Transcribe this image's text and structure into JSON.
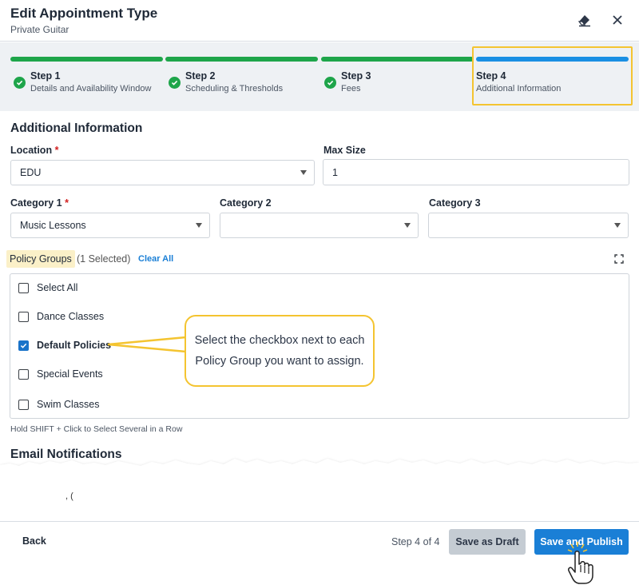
{
  "header": {
    "title": "Edit Appointment Type",
    "subtitle": "Private Guitar"
  },
  "steps": [
    {
      "title": "Step 1",
      "subtitle": "Details and Availability Window",
      "status": "complete"
    },
    {
      "title": "Step 2",
      "subtitle": "Scheduling & Thresholds",
      "status": "complete"
    },
    {
      "title": "Step 3",
      "subtitle": "Fees",
      "status": "complete"
    },
    {
      "title": "Step 4",
      "subtitle": "Additional Information",
      "status": "current"
    }
  ],
  "colors": {
    "complete": "#1ea54a",
    "current": "#1a8fe3",
    "highlight": "#f4c430",
    "primary": "#1a7fd6"
  },
  "section": {
    "title": "Additional Information"
  },
  "fields": {
    "location": {
      "label": "Location",
      "value": "EDU",
      "required": "*"
    },
    "max_size": {
      "label": "Max Size",
      "value": "1"
    },
    "category1": {
      "label": "Category 1",
      "value": "Music Lessons",
      "required": "*"
    },
    "category2": {
      "label": "Category 2",
      "value": ""
    },
    "category3": {
      "label": "Category 3",
      "value": ""
    }
  },
  "policy_groups": {
    "label": "Policy Groups",
    "count": "(1 Selected)",
    "clear": "Clear All",
    "items": [
      {
        "label": "Select All",
        "checked": false
      },
      {
        "label": "Dance Classes",
        "checked": false
      },
      {
        "label": "Default Policies",
        "checked": true
      },
      {
        "label": "Special Events",
        "checked": false
      },
      {
        "label": "Swim Classes",
        "checked": false
      }
    ],
    "hint": "Hold SHIFT + Click to Select Several in a Row"
  },
  "callout": {
    "text": "Select the checkbox next to each Policy Group you want to assign."
  },
  "email": {
    "title": "Email Notifications"
  },
  "stray_text": ", (",
  "footer": {
    "back": "Back",
    "step_of": "Step 4 of 4",
    "draft": "Save as Draft",
    "publish": "Save and Publish"
  }
}
